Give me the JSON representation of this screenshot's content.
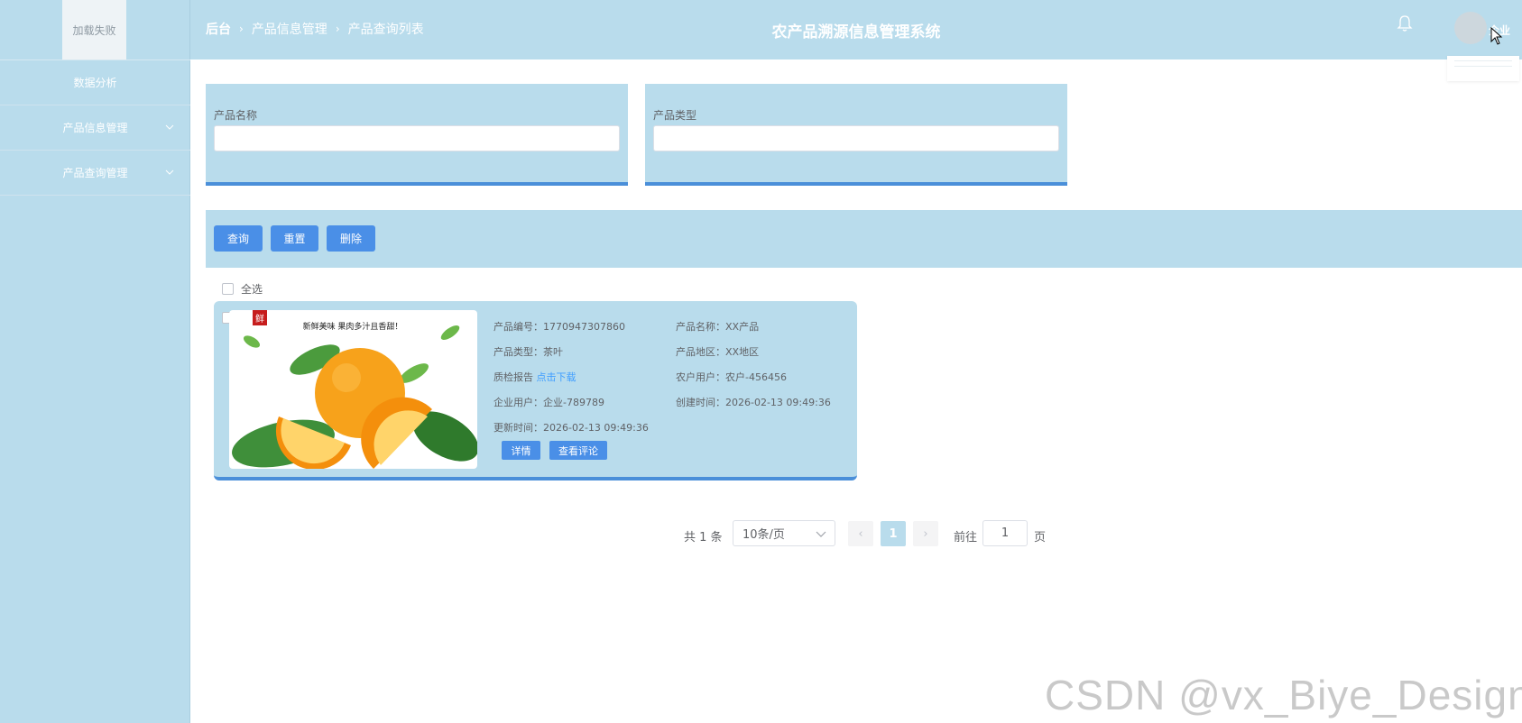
{
  "logo": {
    "text": "加载失败"
  },
  "sidebar": {
    "items": [
      {
        "label": "数据分析",
        "has_chevron": false
      },
      {
        "label": "产品信息管理",
        "has_chevron": true
      },
      {
        "label": "产品查询管理",
        "has_chevron": true
      }
    ]
  },
  "header": {
    "breadcrumb": [
      "后台",
      "产品信息管理",
      "产品查询列表"
    ],
    "title": "农产品溯源信息管理系统",
    "user": "企业"
  },
  "search": {
    "product_name_label": "产品名称",
    "product_name_value": "",
    "product_type_label": "产品类型",
    "product_type_value": ""
  },
  "toolbar": {
    "query": "查询",
    "reset": "重置",
    "delete": "删除"
  },
  "select_all_label": "全选",
  "product": {
    "image_caption": "新鲜美味 果肉多汁且香甜！",
    "image_badge": "鲜",
    "code_label": "产品编号：",
    "code": "1770947307860",
    "name_label": "产品名称：",
    "name": "XX产品",
    "type_label": "产品类型：",
    "type": "茶叶",
    "region_label": "产品地区：",
    "region": "XX地区",
    "report_label": "质检报告 ",
    "report_link": "点击下载",
    "farmer_label": "农户用户：",
    "farmer": "农户-456456",
    "enterprise_label": "企业用户：",
    "enterprise": "企业-789789",
    "created_label": "创建时间：",
    "created": "2026-02-13 09:49:36",
    "updated_label": "更新时间：",
    "updated": "2026-02-13 09:49:36",
    "detail_btn": "详情",
    "comments_btn": "查看评论"
  },
  "pagination": {
    "total": "共 1 条",
    "page_size": "10条/页",
    "prev": "‹",
    "current": "1",
    "next": "›",
    "goto_label": "前往",
    "goto_value": "1",
    "goto_suffix": "页"
  },
  "watermark": "CSDN @vx_Biye_Design",
  "colors": {
    "panel": "#b9dcec",
    "primary": "#4a8fe7",
    "accent_border": "#4a8fd9",
    "link": "#409eff"
  }
}
